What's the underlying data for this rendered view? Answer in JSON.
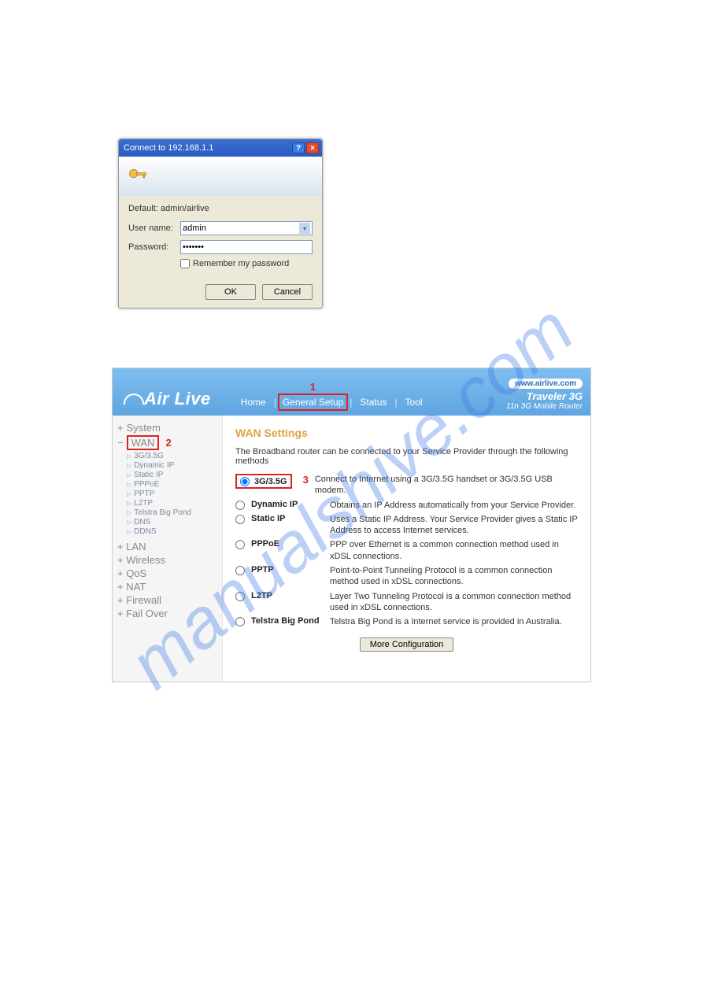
{
  "watermark": "manualshive.com",
  "login": {
    "title": "Connect to 192.168.1.1",
    "default_text": "Default: admin/airlive",
    "user_label": "User name:",
    "user_value": "admin",
    "pass_label": "Password:",
    "pass_value": "•••••••",
    "remember_label": "Remember my password",
    "ok": "OK",
    "cancel": "Cancel"
  },
  "router": {
    "logo": "Air Live",
    "nav": {
      "home": "Home",
      "setup": "General Setup",
      "status": "Status",
      "tool": "Tool"
    },
    "annot1": "1",
    "url": "www.airlive.com",
    "model": "Traveler 3G",
    "sub": "11n 3G Mobile Router",
    "sidebar": {
      "system": "System",
      "wan": "WAN",
      "annot2": "2",
      "subs": [
        "3G/3.5G",
        "Dynamic IP",
        "Static IP",
        "PPPoE",
        "PPTP",
        "L2TP",
        "Telstra Big Pond",
        "DNS",
        "DDNS"
      ],
      "rest": [
        "LAN",
        "Wireless",
        "QoS",
        "NAT",
        "Firewall",
        "Fail Over"
      ]
    },
    "content": {
      "title": "WAN Settings",
      "intro": "The Broadband router can be connected to your Service Provider through the following methods",
      "annot3": "3",
      "options": [
        {
          "label": "3G/3.5G",
          "desc": "Connect to Internet using a 3G/3.5G handset or 3G/3.5G USB modem.",
          "selected": true,
          "highlight": true
        },
        {
          "label": "Dynamic IP",
          "desc": "Obtains an IP Address automatically from your Service Provider."
        },
        {
          "label": "Static IP",
          "desc": "Uses a Static IP Address. Your Service Provider gives a Static IP Address to access Internet services."
        },
        {
          "label": "PPPoE",
          "desc": "PPP over Ethernet is a common connection method used in xDSL connections."
        },
        {
          "label": "PPTP",
          "desc": "Point-to-Point Tunneling Protocol is a common connection method used in xDSL connections."
        },
        {
          "label": "L2TP",
          "desc": "Layer Two Tunneling Protocol is a common connection method used in xDSL connections."
        },
        {
          "label": "Telstra Big Pond",
          "desc": "Telstra Big Pond is a Internet service is provided in Australia."
        }
      ],
      "more": "More Configuration"
    }
  }
}
